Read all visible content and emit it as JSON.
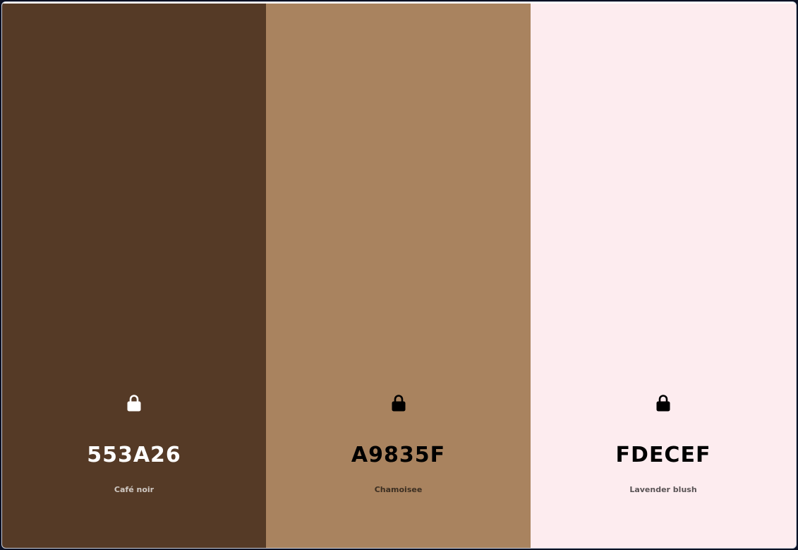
{
  "palette": {
    "swatches": [
      {
        "hex": "553A26",
        "name": "Café noir",
        "color": "#553A26",
        "text_color": "#FFFFFF",
        "icon": "lock-icon"
      },
      {
        "hex": "A9835F",
        "name": "Chamoisee",
        "color": "#A9835F",
        "text_color": "#000000",
        "icon": "lock-icon"
      },
      {
        "hex": "FDECEF",
        "name": "Lavender blush",
        "color": "#FDECEF",
        "text_color": "#000000",
        "icon": "lock-icon"
      }
    ]
  }
}
